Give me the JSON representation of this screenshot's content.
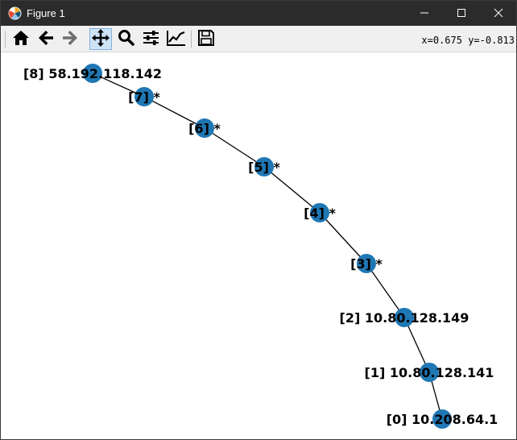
{
  "window": {
    "title": "Figure 1",
    "controls": {
      "minimize": "minimize-icon",
      "maximize": "maximize-icon",
      "close": "close-icon"
    }
  },
  "toolbar": {
    "buttons": [
      {
        "name": "home-button",
        "icon": "home-icon",
        "active": false
      },
      {
        "name": "back-button",
        "icon": "arrow-left-icon",
        "active": false
      },
      {
        "name": "forward-button",
        "icon": "arrow-right-icon",
        "active": false
      },
      {
        "name": "pan-button",
        "icon": "move-icon",
        "active": true
      },
      {
        "name": "zoom-button",
        "icon": "magnifier-icon",
        "active": false
      },
      {
        "name": "configure-subplots-button",
        "icon": "sliders-icon",
        "active": false
      },
      {
        "name": "edit-axis-button",
        "icon": "line-chart-icon",
        "active": false
      },
      {
        "name": "save-button",
        "icon": "floppy-disk-icon",
        "active": false
      }
    ],
    "coordinates": "x=0.675 y=-0.813"
  },
  "graph": {
    "node_color": "#1f77b4",
    "edge_color": "#000000",
    "nodes": [
      {
        "id": 0,
        "label": "[0] 10.208.64.1"
      },
      {
        "id": 1,
        "label": "[1] 10.80.128.141"
      },
      {
        "id": 2,
        "label": "[2] 10.80.128.149"
      },
      {
        "id": 3,
        "label": "[3] *"
      },
      {
        "id": 4,
        "label": "[4] *"
      },
      {
        "id": 5,
        "label": "[5] *"
      },
      {
        "id": 6,
        "label": "[6] *"
      },
      {
        "id": 7,
        "label": "[7] *"
      },
      {
        "id": 8,
        "label": "[8] 58.192.118.142"
      }
    ],
    "edges": [
      [
        0,
        1
      ],
      [
        1,
        2
      ],
      [
        2,
        3
      ],
      [
        3,
        4
      ],
      [
        4,
        5
      ],
      [
        5,
        6
      ],
      [
        6,
        7
      ],
      [
        7,
        8
      ]
    ]
  }
}
